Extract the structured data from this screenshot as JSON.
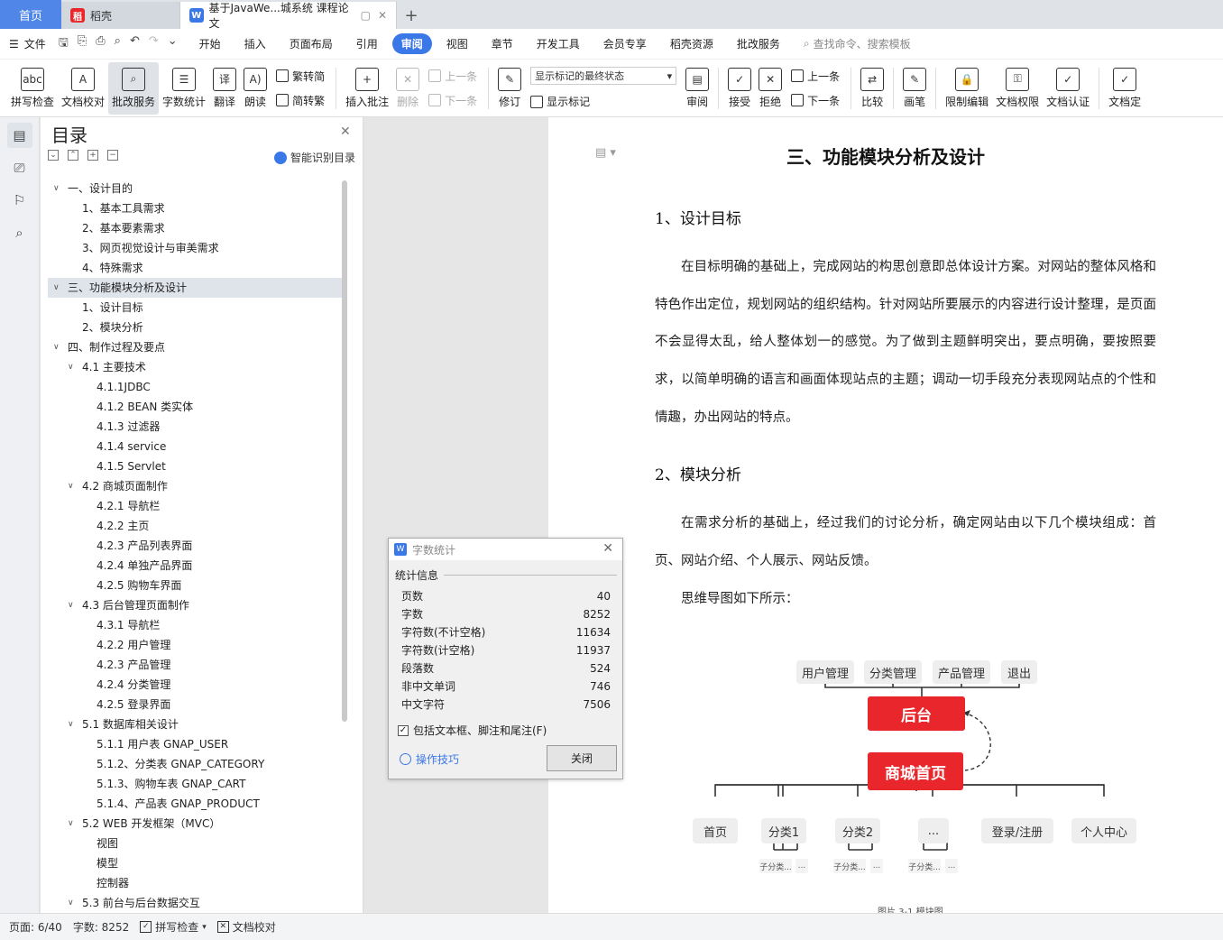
{
  "tabs": {
    "home": "首页",
    "docer": "稻壳",
    "doc_title": "基于JavaWe...城系统 课程论文"
  },
  "menu": {
    "file": "文件",
    "tabs": [
      "开始",
      "插入",
      "页面布局",
      "引用",
      "审阅",
      "视图",
      "章节",
      "开发工具",
      "会员专享",
      "稻壳资源",
      "批改服务"
    ],
    "active": "审阅",
    "search": "查找命令、搜索模板"
  },
  "ribbon": {
    "spell": "拼写检查",
    "proof": "文档校对",
    "correct": "批改服务",
    "wordcount": "字数统计",
    "translate": "翻译",
    "read": "朗读",
    "to_simp": "繁转简",
    "to_trad": "简转繁",
    "insert_comment": "插入批注",
    "delete": "删除",
    "prev": "上一条",
    "next": "下一条",
    "revise": "修订",
    "markup_select": "显示标记的最终状态",
    "show_markup": "显示标记",
    "review": "审阅",
    "accept": "接受",
    "reject": "拒绝",
    "prev2": "上一条",
    "next2": "下一条",
    "compare": "比较",
    "pen": "画笔",
    "restrict": "限制编辑",
    "permission": "文档权限",
    "certify": "文档认证",
    "finalize": "文档定"
  },
  "toc": {
    "title": "目录",
    "smart": "智能识别目录",
    "items": [
      {
        "t": "一、设计目的",
        "l": 1,
        "a": "v"
      },
      {
        "t": "1、基本工具需求",
        "l": 2
      },
      {
        "t": "2、基本要素需求",
        "l": 2
      },
      {
        "t": "3、网页视觉设计与审美需求",
        "l": 2
      },
      {
        "t": "4、特殊需求",
        "l": 2
      },
      {
        "t": "三、功能模块分析及设计",
        "l": 1,
        "a": "v",
        "sel": true
      },
      {
        "t": "1、设计目标",
        "l": 2
      },
      {
        "t": "2、模块分析",
        "l": 2
      },
      {
        "t": "四、制作过程及要点",
        "l": 1,
        "a": "v"
      },
      {
        "t": "4.1 主要技术",
        "l": 2,
        "a": "v"
      },
      {
        "t": "4.1.1JDBC",
        "l": 3
      },
      {
        "t": "4.1.2 BEAN 类实体",
        "l": 3
      },
      {
        "t": "4.1.3 过滤器",
        "l": 3
      },
      {
        "t": "4.1.4 service",
        "l": 3
      },
      {
        "t": "4.1.5 Servlet",
        "l": 3
      },
      {
        "t": "4.2 商城页面制作",
        "l": 2,
        "a": "v"
      },
      {
        "t": "4.2.1 导航栏",
        "l": 3
      },
      {
        "t": "4.2.2 主页",
        "l": 3
      },
      {
        "t": "4.2.3 产品列表界面",
        "l": 3
      },
      {
        "t": "4.2.4 单独产品界面",
        "l": 3
      },
      {
        "t": "4.2.5 购物车界面",
        "l": 3
      },
      {
        "t": "4.3 后台管理页面制作",
        "l": 2,
        "a": "v"
      },
      {
        "t": "4.3.1 导航栏",
        "l": 3
      },
      {
        "t": "4.2.2 用户管理",
        "l": 3
      },
      {
        "t": "4.2.3 产品管理",
        "l": 3
      },
      {
        "t": "4.2.4 分类管理",
        "l": 3
      },
      {
        "t": "4.2.5 登录界面",
        "l": 3
      },
      {
        "t": "5.1 数据库相关设计",
        "l": 2,
        "a": "v"
      },
      {
        "t": "5.1.1 用户表 GNAP_USER",
        "l": 3
      },
      {
        "t": "5.1.2、分类表 GNAP_CATEGORY",
        "l": 3
      },
      {
        "t": "5.1.3、购物车表 GNAP_CART",
        "l": 3
      },
      {
        "t": "5.1.4、产品表 GNAP_PRODUCT",
        "l": 3
      },
      {
        "t": "5.2 WEB 开发框架（MVC）",
        "l": 2,
        "a": "v"
      },
      {
        "t": "视图",
        "l": 3
      },
      {
        "t": "模型",
        "l": 3
      },
      {
        "t": "控制器",
        "l": 3
      },
      {
        "t": "5.3 前台与后台数据交互",
        "l": 2,
        "a": "v"
      }
    ]
  },
  "doc": {
    "h1": "三、功能模块分析及设计",
    "h2a": "1、设计目标",
    "p1": "在目标明确的基础上，完成网站的构思创意即总体设计方案。对网站的整体风格和特色作出定位，规划网站的组织结构。针对网站所要展示的内容进行设计整理，是页面不会显得太乱，给人整体划一的感觉。为了做到主题鲜明突出，要点明确，要按照要求，以简单明确的语言和画面体现站点的主题；调动一切手段充分表现网站点的个性和情趣，办出网站的特点。",
    "h2b": "2、模块分析",
    "p2": "在需求分析的基础上，经过我们的讨论分析，确定网站由以下几个模块组成：首页、网站介绍、个人展示、网站反馈。",
    "p3": "思维导图如下所示：",
    "mm": {
      "top": [
        "用户管理",
        "分类管理",
        "产品管理",
        "退出"
      ],
      "backend": "后台",
      "home": "商城首页",
      "bottom": [
        "首页",
        "分类1",
        "分类2",
        "...",
        "登录/注册",
        "个人中心"
      ],
      "sub": [
        "子分类...",
        "..."
      ],
      "caption": "图片 3-1  模块图"
    }
  },
  "dialog": {
    "title": "字数统计",
    "section": "统计信息",
    "rows": [
      {
        "k": "页数",
        "v": "40"
      },
      {
        "k": "字数",
        "v": "8252"
      },
      {
        "k": "字符数(不计空格)",
        "v": "11634"
      },
      {
        "k": "字符数(计空格)",
        "v": "11937"
      },
      {
        "k": "段落数",
        "v": "524"
      },
      {
        "k": "非中文单词",
        "v": "746"
      },
      {
        "k": "中文字符",
        "v": "7506"
      }
    ],
    "include": "包括文本框、脚注和尾注(F)",
    "tips": "操作技巧",
    "close": "关闭"
  },
  "status": {
    "page": "页面: 6/40",
    "words": "字数: 8252",
    "spell": "拼写检查",
    "proof": "文档校对"
  }
}
